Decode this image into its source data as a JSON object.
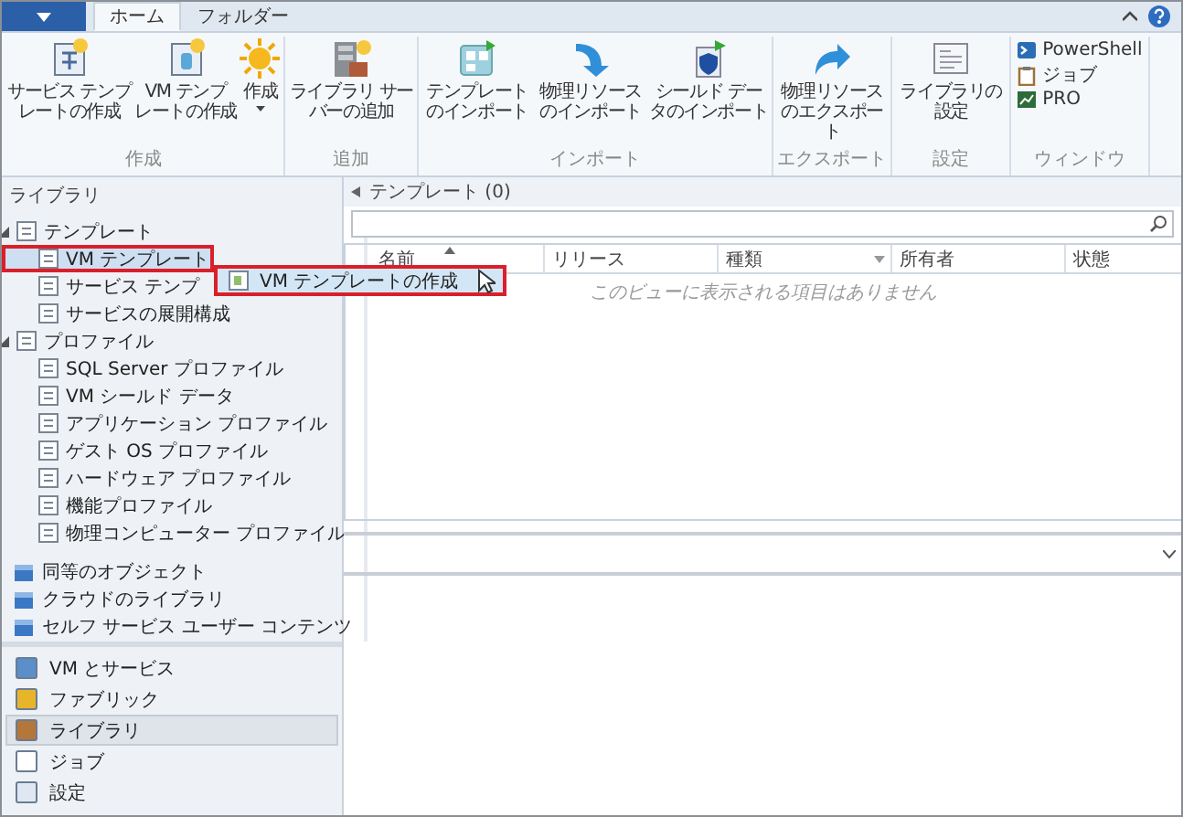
{
  "tabs": [
    {
      "label": "ホーム",
      "selected": true
    },
    {
      "label": "フォルダー",
      "selected": false
    }
  ],
  "ribbon": {
    "groups": [
      {
        "label": "作成",
        "buttons": [
          {
            "lines": [
              "サービス テンプ",
              "レートの作成"
            ],
            "kind": "large"
          },
          {
            "lines": [
              "VM テンプ",
              "レートの作成"
            ],
            "kind": "large"
          },
          {
            "lines": [
              "作成"
            ],
            "kind": "large",
            "dropdown": true
          }
        ]
      },
      {
        "label": "追加",
        "buttons": [
          {
            "lines": [
              "ライブラリ サー",
              "バーの追加"
            ],
            "kind": "large"
          }
        ]
      },
      {
        "label": "インポート",
        "buttons": [
          {
            "lines": [
              "テンプレートのインポート"
            ],
            "kind": "large"
          },
          {
            "lines": [
              "物理リソースのインポート"
            ],
            "kind": "large"
          },
          {
            "lines": [
              "シールド デー",
              "タのインポート"
            ],
            "kind": "large"
          }
        ]
      },
      {
        "label": "エクスポート",
        "buttons": [
          {
            "lines": [
              "物理リソースのエクスポート"
            ],
            "kind": "large"
          }
        ]
      },
      {
        "label": "設定",
        "buttons": [
          {
            "lines": [
              "ライブラリの設定"
            ],
            "kind": "large"
          }
        ]
      },
      {
        "label": "ウィンドウ",
        "buttons": [
          {
            "lines": [
              "PowerShell"
            ],
            "kind": "small"
          },
          {
            "lines": [
              "ジョブ"
            ],
            "kind": "small"
          },
          {
            "lines": [
              "PRO"
            ],
            "kind": "small"
          }
        ]
      }
    ]
  },
  "library": {
    "title": "ライブラリ",
    "tree": [
      {
        "label": "テンプレート",
        "expanded": true,
        "selected": false,
        "children": [
          {
            "label": "VM テンプレート",
            "selected": true,
            "highlighted": true
          },
          {
            "label": "サービス テンプ",
            "selected": false
          },
          {
            "label": "サービスの展開構成",
            "selected": false
          }
        ]
      },
      {
        "label": "プロファイル",
        "expanded": true,
        "selected": false,
        "children": [
          {
            "label": "SQL Server プロファイル",
            "selected": false
          },
          {
            "label": "VM シールド データ",
            "selected": false
          },
          {
            "label": "アプリケーション プロファイル",
            "selected": false
          },
          {
            "label": "ゲスト OS プロファイル",
            "selected": false
          },
          {
            "label": "ハードウェア プロファイル",
            "selected": false
          },
          {
            "label": "機能プロファイル",
            "selected": false
          },
          {
            "label": "物理コンピューター プロファイル",
            "selected": false
          }
        ]
      },
      {
        "label": "同等のオブジェクト",
        "selected": false
      },
      {
        "label": "クラウドのライブラリ",
        "selected": false
      },
      {
        "label": "セルフ サービス ユーザー コンテンツ",
        "selected": false
      }
    ]
  },
  "navigation": [
    {
      "label": "VM とサービス",
      "selected": false
    },
    {
      "label": "ファブリック",
      "selected": false
    },
    {
      "label": "ライブラリ",
      "selected": true
    },
    {
      "label": "ジョブ",
      "selected": false
    },
    {
      "label": "設定",
      "selected": false
    }
  ],
  "context_menu": {
    "items": [
      {
        "label": "VM テンプレートの作成",
        "highlighted": true
      }
    ]
  },
  "content": {
    "title": "テンプレート (0)",
    "columns": [
      {
        "label": "名前",
        "sort_ascending": true
      },
      {
        "label": "リリース"
      },
      {
        "label": "種類",
        "filter": true
      },
      {
        "label": "所有者"
      },
      {
        "label": "状態"
      }
    ],
    "empty_message": "このビューに表示される項目はありません"
  }
}
